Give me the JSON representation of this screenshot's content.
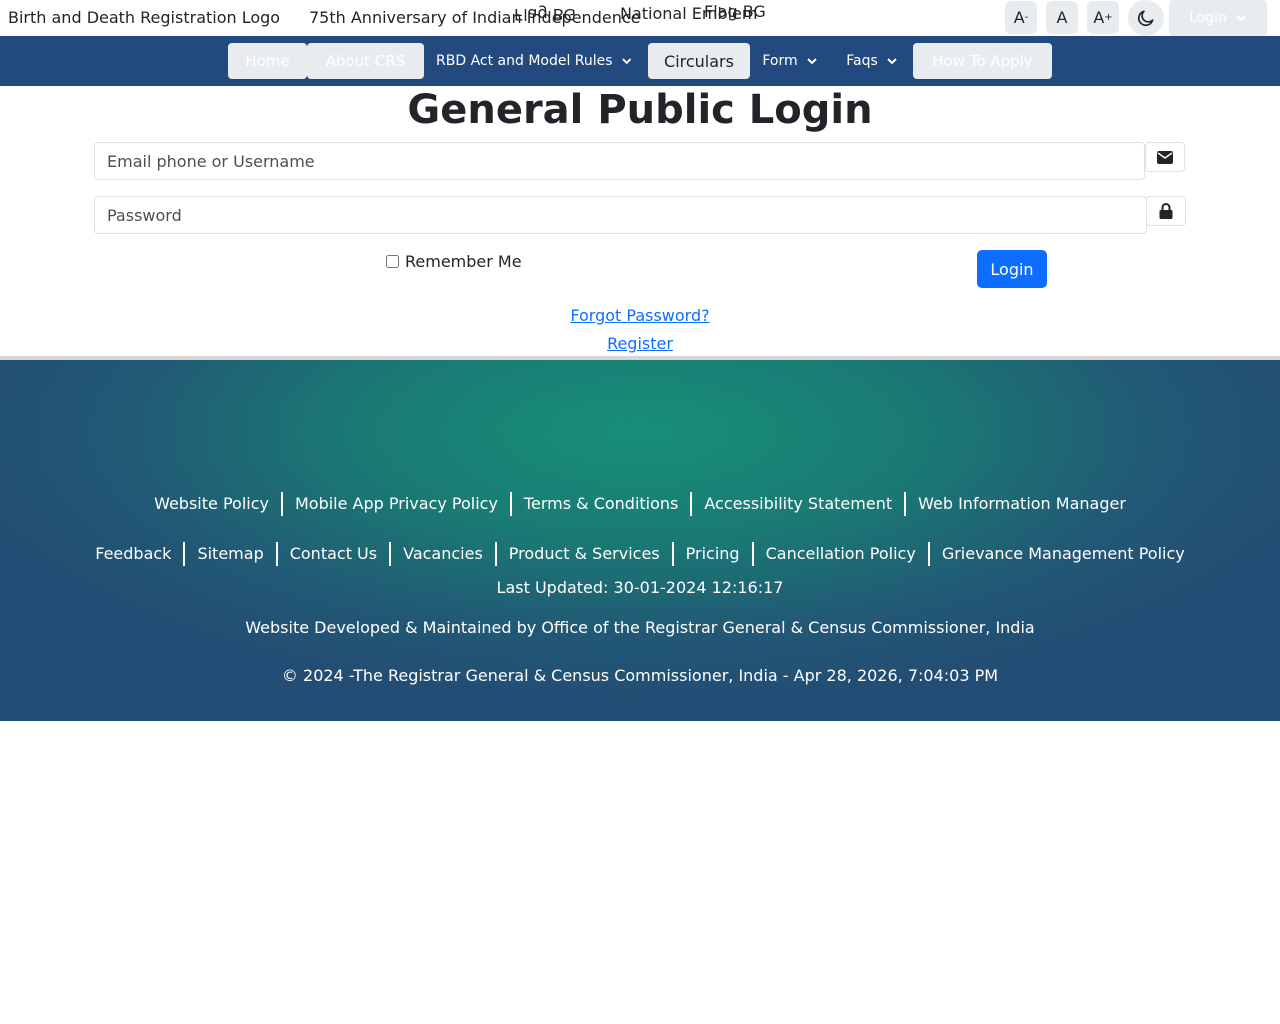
{
  "header": {
    "logo_alt": "Birth and Death Registration Logo",
    "anniversary_alt": "75th Anniversary of Indian Independence",
    "flag_bg_left_alt": "Flag BG",
    "emblem_alt": "National Emblem",
    "flag_bg_right_alt": "Flag BG",
    "font_decrease": "A",
    "font_decrease_sup": "-",
    "font_reset": "A",
    "font_increase": "A",
    "font_increase_sup": "+",
    "theme_icon": "moon-icon",
    "login_menu_label": "Login"
  },
  "nav": {
    "home": "Home",
    "about": "About CRS",
    "rbd_act": "RBD Act and Model Rules",
    "circulars": "Circulars",
    "form": "Form",
    "faqs": "Faqs",
    "how_to_apply": "How To Apply"
  },
  "login": {
    "title": "General Public Login",
    "username_placeholder": "Email phone or Username",
    "username_value": "",
    "password_placeholder": "Password",
    "password_value": "",
    "remember_label": "Remember Me",
    "remember_checked": false,
    "submit_label": "Login",
    "forgot_link": "Forgot Password?",
    "register_link": "Register"
  },
  "footer": {
    "links_row1": [
      "Website Policy",
      "Mobile App Privacy Policy",
      "Terms & Conditions",
      "Accessibility Statement",
      "Web Information Manager"
    ],
    "links_row2": [
      "Feedback",
      "Sitemap",
      "Contact Us",
      "Vacancies",
      "Product & Services",
      "Pricing",
      "Cancellation Policy",
      "Grievance Management Policy"
    ],
    "last_updated": "Last Updated: 30-01-2024 12:16:17",
    "developed_by": "Website Developed & Maintained by Office of the Registrar General & Census Commissioner, India",
    "copyright": "© 2024 -The Registrar General & Census Commissioner, India - Apr 28, 2026, 7:04:03 PM"
  },
  "colors": {
    "nav_bg": "#234a7e",
    "primary_button": "#0d6efd",
    "footer_teal": "#178f78",
    "footer_blue": "#234d74"
  }
}
